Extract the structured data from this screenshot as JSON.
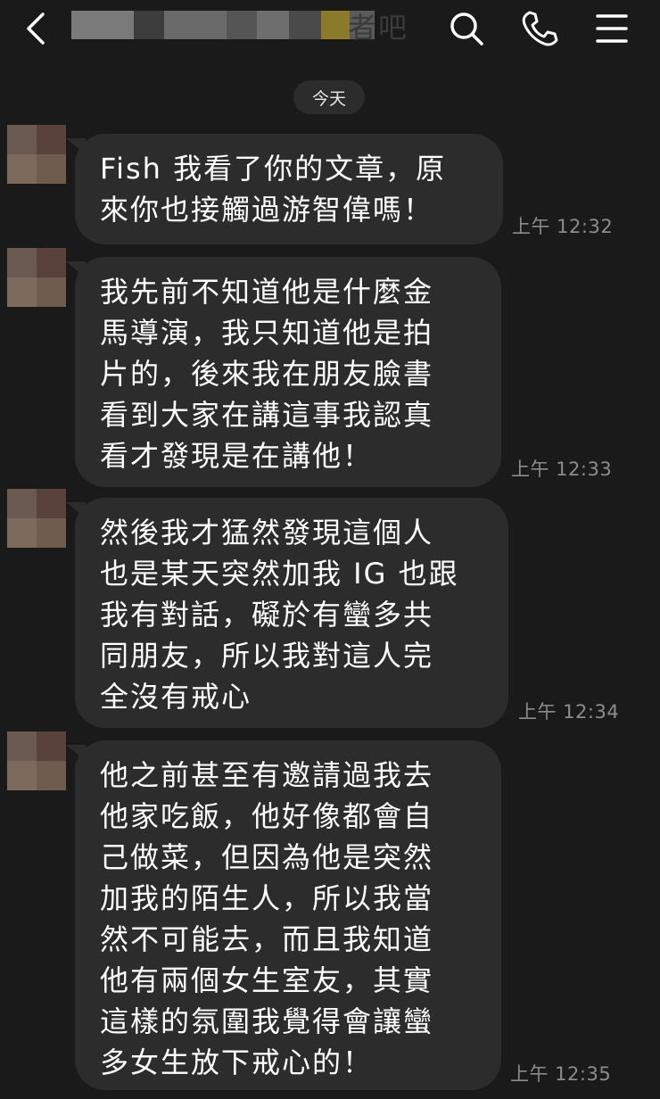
{
  "header": {
    "title_visible": "者吧",
    "back_icon": "chevron-left-icon",
    "search_icon": "search-icon",
    "call_icon": "phone-icon",
    "menu_icon": "menu-icon"
  },
  "date_separator": "今天",
  "messages": [
    {
      "lines": [
        "Fish 我看了你的文章，原",
        "來你也接觸過游智偉嗎！"
      ],
      "time": "上午 12:32"
    },
    {
      "lines": [
        "我先前不知道他是什麼金",
        "馬導演，我只知道他是拍",
        "片的，後來我在朋友臉書",
        "看到大家在講這事我認真",
        "看才發現是在講他！"
      ],
      "time": "上午 12:33"
    },
    {
      "lines": [
        "然後我才猛然發現這個人",
        "也是某天突然加我 IG 也跟",
        "我有對話，礙於有蠻多共",
        "同朋友，所以我對這人完",
        "全沒有戒心"
      ],
      "time": "上午 12:34"
    },
    {
      "lines": [
        "他之前甚至有邀請過我去",
        "他家吃飯，他好像都會自",
        "己做菜，但因為他是突然",
        "加我的陌生人，所以我當",
        "然不可能去，而且我知道",
        "他有兩個女生室友，其實",
        "這樣的氛圍我覺得會讓蠻",
        "多女生放下戒心的！"
      ],
      "time": "上午 12:35"
    }
  ]
}
